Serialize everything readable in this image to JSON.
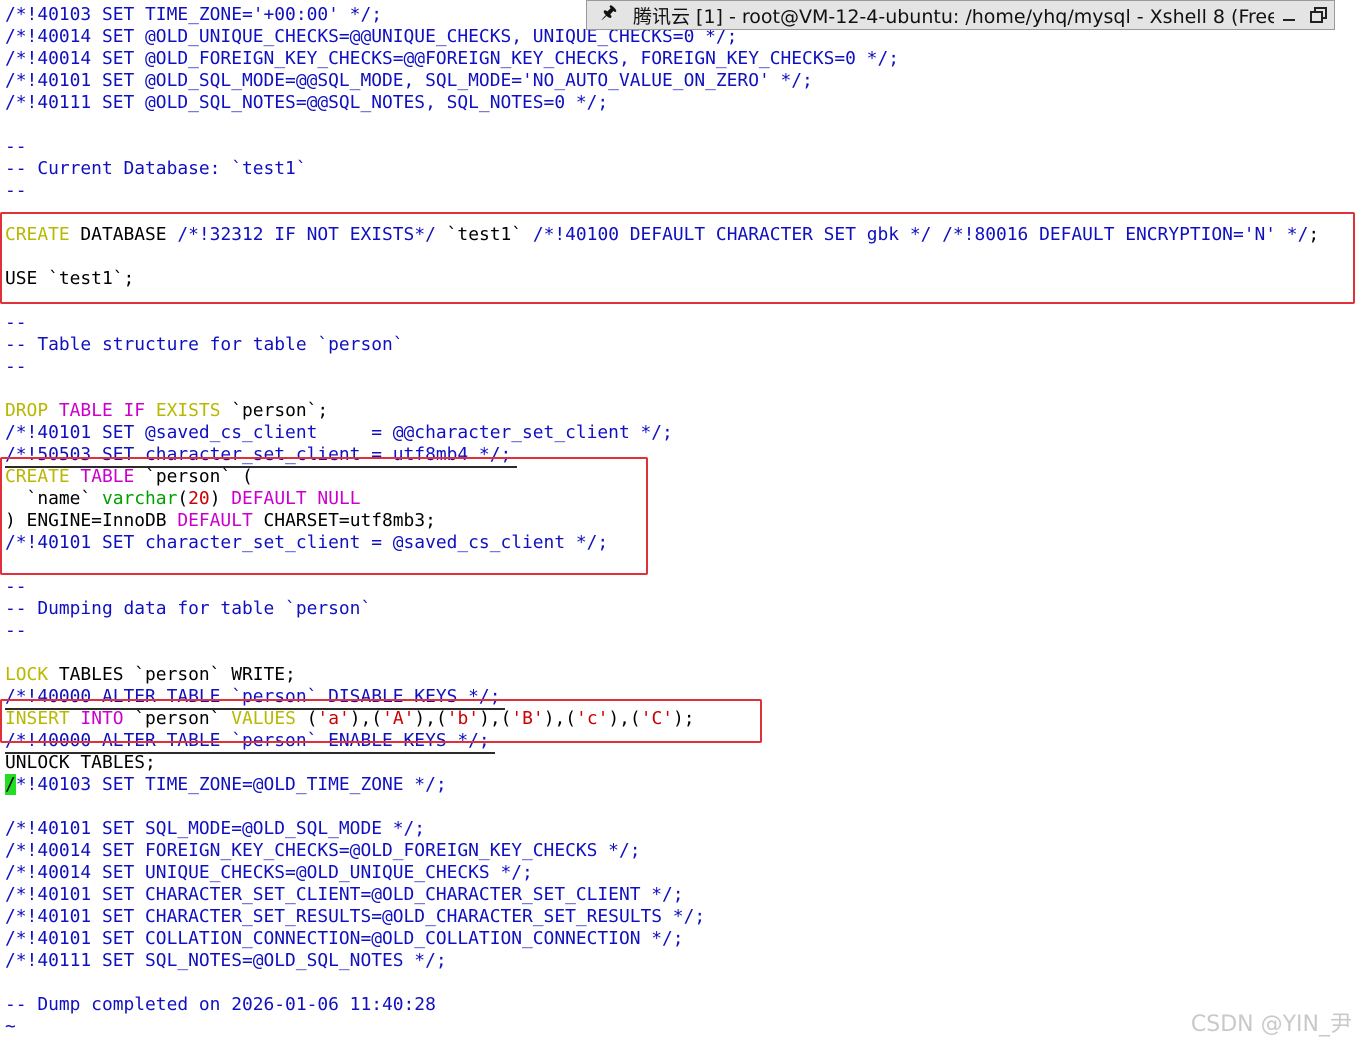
{
  "window": {
    "title": "腾讯云 [1] - root@VM-12-4-ubuntu: /home/yhq/mysql - Xshell 8 (Free"
  },
  "colors": {
    "comment": "#1010c0",
    "keyword": "#b8b800",
    "magenta": "#cc00cc",
    "type": "#00a000",
    "number": "#cc0000",
    "string": "#cc0000",
    "text": "#000000",
    "highlight_box": "#e0303a",
    "cursor": "#22dd22"
  },
  "lines": [
    [
      {
        "t": "/*!40103 SET TIME_ZONE='+00:00' */;",
        "c": "comment"
      }
    ],
    [
      {
        "t": "/*!40014 SET @OLD_UNIQUE_CHECKS=@@UNIQUE_CHECKS, UNIQUE_CHECKS=0 */;",
        "c": "comment"
      }
    ],
    [
      {
        "t": "/*!40014 SET @OLD_FOREIGN_KEY_CHECKS=@@FOREIGN_KEY_CHECKS, FOREIGN_KEY_CHECKS=0 */;",
        "c": "comment"
      }
    ],
    [
      {
        "t": "/*!40101 SET @OLD_SQL_MODE=@@SQL_MODE, SQL_MODE='NO_AUTO_VALUE_ON_ZERO' */;",
        "c": "comment"
      }
    ],
    [
      {
        "t": "/*!40111 SET @OLD_SQL_NOTES=@@SQL_NOTES, SQL_NOTES=0 */;",
        "c": "comment"
      }
    ],
    [],
    [
      {
        "t": "--",
        "c": "comment"
      }
    ],
    [
      {
        "t": "-- Current Database: `test1`",
        "c": "comment"
      }
    ],
    [
      {
        "t": "--",
        "c": "comment"
      }
    ],
    [],
    [
      {
        "t": "CREATE",
        "c": "keyword"
      },
      {
        "t": " DATABASE ",
        "c": "text"
      },
      {
        "t": "/*!32312 IF NOT EXISTS*/",
        "c": "comment"
      },
      {
        "t": " `test1` ",
        "c": "text"
      },
      {
        "t": "/*!40100 DEFAULT CHARACTER SET gbk */ /*!80016 DEFAULT ENCRYPTION='N' */",
        "c": "comment"
      },
      {
        "t": ";",
        "c": "text"
      }
    ],
    [],
    [
      {
        "t": "USE `test1`;",
        "c": "text"
      }
    ],
    [],
    [
      {
        "t": "--",
        "c": "comment"
      }
    ],
    [
      {
        "t": "-- Table structure for table `person`",
        "c": "comment"
      }
    ],
    [
      {
        "t": "--",
        "c": "comment"
      }
    ],
    [],
    [
      {
        "t": "DROP",
        "c": "keyword"
      },
      {
        "t": " ",
        "c": "text"
      },
      {
        "t": "TABLE",
        "c": "magenta"
      },
      {
        "t": " ",
        "c": "text"
      },
      {
        "t": "IF",
        "c": "magenta"
      },
      {
        "t": " ",
        "c": "text"
      },
      {
        "t": "EXISTS",
        "c": "keyword"
      },
      {
        "t": " `person`;",
        "c": "text"
      }
    ],
    [
      {
        "t": "/*!40101 SET @saved_cs_client     = @@character_set_client */;",
        "c": "comment"
      }
    ],
    [
      {
        "t": "/*!50503 SET character_set_client = utf8mb4 */;",
        "c": "comment"
      }
    ],
    [
      {
        "t": "CREATE",
        "c": "keyword"
      },
      {
        "t": " ",
        "c": "text"
      },
      {
        "t": "TABLE",
        "c": "magenta"
      },
      {
        "t": " `person` (",
        "c": "text"
      }
    ],
    [
      {
        "t": "  `name` ",
        "c": "text"
      },
      {
        "t": "varchar",
        "c": "type"
      },
      {
        "t": "(",
        "c": "text"
      },
      {
        "t": "20",
        "c": "number"
      },
      {
        "t": ") ",
        "c": "text"
      },
      {
        "t": "DEFAULT",
        "c": "magenta"
      },
      {
        "t": " ",
        "c": "text"
      },
      {
        "t": "NULL",
        "c": "magenta"
      }
    ],
    [
      {
        "t": ") ENGINE=InnoDB ",
        "c": "text"
      },
      {
        "t": "DEFAULT",
        "c": "magenta"
      },
      {
        "t": " CHARSET=utf8mb3;",
        "c": "text"
      }
    ],
    [
      {
        "t": "/*!40101 SET character_set_client = @saved_cs_client */;",
        "c": "comment"
      }
    ],
    [],
    [
      {
        "t": "--",
        "c": "comment"
      }
    ],
    [
      {
        "t": "-- Dumping data for table `person`",
        "c": "comment"
      }
    ],
    [
      {
        "t": "--",
        "c": "comment"
      }
    ],
    [],
    [
      {
        "t": "LOCK",
        "c": "keyword"
      },
      {
        "t": " TABLES `person` WRITE;",
        "c": "text"
      }
    ],
    [
      {
        "t": "/*!40000 ALTER TABLE `person` DISABLE KEYS */;",
        "c": "comment"
      }
    ],
    [
      {
        "t": "INSERT",
        "c": "keyword"
      },
      {
        "t": " ",
        "c": "text"
      },
      {
        "t": "INTO",
        "c": "magenta"
      },
      {
        "t": " `person` ",
        "c": "text"
      },
      {
        "t": "VALUES",
        "c": "keyword"
      },
      {
        "t": " (",
        "c": "text"
      },
      {
        "t": "'a'",
        "c": "string"
      },
      {
        "t": "),(",
        "c": "text"
      },
      {
        "t": "'A'",
        "c": "string"
      },
      {
        "t": "),(",
        "c": "text"
      },
      {
        "t": "'b'",
        "c": "string"
      },
      {
        "t": "),(",
        "c": "text"
      },
      {
        "t": "'B'",
        "c": "string"
      },
      {
        "t": "),(",
        "c": "text"
      },
      {
        "t": "'c'",
        "c": "string"
      },
      {
        "t": "),(",
        "c": "text"
      },
      {
        "t": "'C'",
        "c": "string"
      },
      {
        "t": ");",
        "c": "text"
      }
    ],
    [
      {
        "t": "/*!40000 ALTER TABLE `person` ENABLE KEYS */;",
        "c": "comment"
      }
    ],
    [
      {
        "t": "UNLOCK TABLES;",
        "c": "text"
      }
    ],
    [
      {
        "t": "/",
        "c": "cursor"
      },
      {
        "t": "*!40103 SET TIME_ZONE=@OLD_TIME_ZONE */;",
        "c": "comment"
      }
    ],
    [],
    [
      {
        "t": "/*!40101 SET SQL_MODE=@OLD_SQL_MODE */;",
        "c": "comment"
      }
    ],
    [
      {
        "t": "/*!40014 SET FOREIGN_KEY_CHECKS=@OLD_FOREIGN_KEY_CHECKS */;",
        "c": "comment"
      }
    ],
    [
      {
        "t": "/*!40014 SET UNIQUE_CHECKS=@OLD_UNIQUE_CHECKS */;",
        "c": "comment"
      }
    ],
    [
      {
        "t": "/*!40101 SET CHARACTER_SET_CLIENT=@OLD_CHARACTER_SET_CLIENT */;",
        "c": "comment"
      }
    ],
    [
      {
        "t": "/*!40101 SET CHARACTER_SET_RESULTS=@OLD_CHARACTER_SET_RESULTS */;",
        "c": "comment"
      }
    ],
    [
      {
        "t": "/*!40101 SET COLLATION_CONNECTION=@OLD_COLLATION_CONNECTION */;",
        "c": "comment"
      }
    ],
    [
      {
        "t": "/*!40111 SET SQL_NOTES=@OLD_SQL_NOTES */;",
        "c": "comment"
      }
    ],
    [],
    [
      {
        "t": "-- Dump completed on 2026-01-06 11:40:28",
        "c": "comment"
      }
    ],
    [
      {
        "t": "~",
        "c": "comment"
      }
    ]
  ],
  "watermark": "CSDN @YIN_尹"
}
